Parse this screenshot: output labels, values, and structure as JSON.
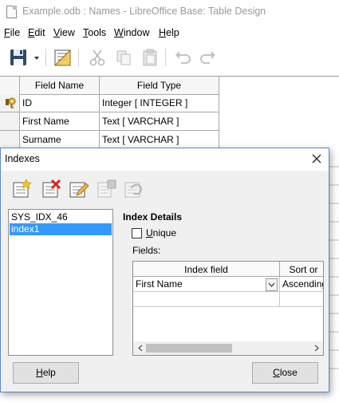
{
  "window": {
    "title": "Example.odb : Names - LibreOffice Base: Table Design"
  },
  "menu": [
    {
      "label": "File",
      "accel": "F",
      "rest": "ile"
    },
    {
      "label": "Edit",
      "accel": "E",
      "rest": "dit"
    },
    {
      "label": "View",
      "accel": "V",
      "rest": "iew"
    },
    {
      "label": "Tools",
      "accel": "T",
      "rest": "ools"
    },
    {
      "label": "Window",
      "accel": "W",
      "rest": "indow"
    },
    {
      "label": "Help",
      "accel": "H",
      "rest": "elp"
    }
  ],
  "toolbar": {
    "icons": [
      "save-icon",
      "dropdown-arrow-icon",
      "index-design-icon",
      "cut-icon",
      "copy-icon",
      "paste-icon",
      "undo-icon",
      "redo-icon"
    ]
  },
  "table_design": {
    "columns": [
      "Field Name",
      "Field Type"
    ],
    "rows": [
      {
        "name": "ID",
        "type": "Integer [ INTEGER ]",
        "primary_key": true
      },
      {
        "name": "First Name",
        "type": "Text [ VARCHAR ]",
        "primary_key": false
      },
      {
        "name": "Surname",
        "type": "Text [ VARCHAR ]",
        "primary_key": false
      }
    ]
  },
  "indexes_dialog": {
    "title": "Indexes",
    "tool_icons": [
      "new-index-icon",
      "delete-index-icon",
      "rename-index-icon",
      "save-index-icon",
      "reset-index-icon"
    ],
    "index_list": [
      "SYS_IDX_46",
      "index1"
    ],
    "selected_index": "index1",
    "details_title": "Index Details",
    "unique_label": {
      "accel": "U",
      "rest": "nique"
    },
    "unique_checked": false,
    "fields_label": "Fields:",
    "fields_columns": [
      "Index field",
      "Sort or"
    ],
    "fields_rows": [
      {
        "field": "First Name",
        "sort": "Ascending"
      },
      {
        "field": "",
        "sort": ""
      }
    ],
    "help_button": {
      "accel": "H",
      "rest": "elp"
    },
    "close_button": {
      "accel": "C",
      "rest": "lose"
    }
  }
}
